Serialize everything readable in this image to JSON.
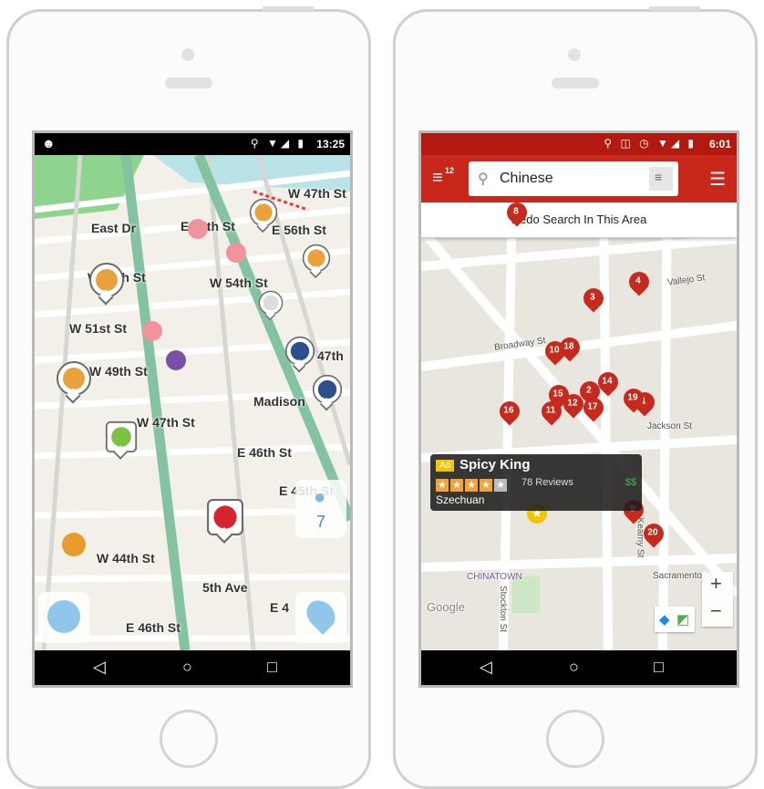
{
  "waze": {
    "status": {
      "time": "13:25",
      "icons": "⚲ ▼◢ ▮"
    },
    "streets": [
      {
        "name": "W 47th St"
      },
      {
        "name": "East Dr"
      },
      {
        "name": "E 57th St"
      },
      {
        "name": "E 56th St"
      },
      {
        "name": "W 55th St"
      },
      {
        "name": "W 54th St"
      },
      {
        "name": "W 51st St"
      },
      {
        "name": "W 49th St"
      },
      {
        "name": "47th"
      },
      {
        "name": "Madison"
      },
      {
        "name": "W 47th St"
      },
      {
        "name": "E 46th St"
      },
      {
        "name": "E 45th St"
      },
      {
        "name": "W 44th St"
      },
      {
        "name": "5th Ave"
      },
      {
        "name": "E 4"
      },
      {
        "name": "E 46th St"
      }
    ],
    "user_count": "7"
  },
  "yelp": {
    "status": {
      "time": "6:01",
      "icons": "⚲ ◫ ◷ ▼◢ ▮"
    },
    "menu_badge": "12",
    "search": {
      "value": "Chinese"
    },
    "redo_button": "Redo Search In This Area",
    "map_labels": [
      "Broadway St",
      "Vallejo St",
      "CHINATOWN",
      "Stockton St",
      "Google",
      "Jackson St",
      "Kearny St",
      "Sacramento St"
    ],
    "pins": [
      "8",
      "4",
      "3",
      "10",
      "18",
      "2",
      "14",
      "15",
      "12",
      "17",
      "1",
      "16",
      "11",
      "9",
      "20",
      "19"
    ],
    "card": {
      "ad": "Ad",
      "name": "Spicy King",
      "reviews": "78 Reviews",
      "price": "$$",
      "category": "Szechuan",
      "rating": 4
    },
    "zoom_in": "+",
    "zoom_out": "−"
  }
}
